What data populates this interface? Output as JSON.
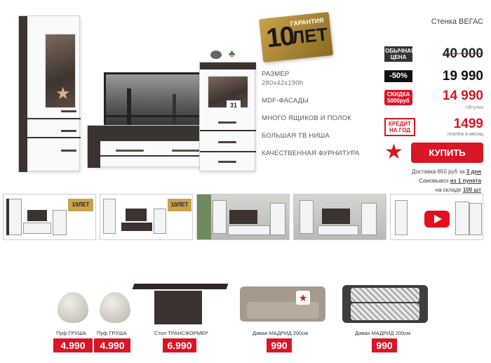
{
  "hero": {
    "guarantee": {
      "number": "10",
      "word": "ЛЕТ",
      "caption": "ГАРАНТИЯ"
    },
    "specs": [
      {
        "title": "РАЗМЕР",
        "sub": "280x42x190h"
      },
      {
        "title": "MDF-ФАСАДЫ",
        "sub": ""
      },
      {
        "title": "МНОГО ЯЩИКОВ И ПОЛОК",
        "sub": ""
      },
      {
        "title": "БОЛЬШАЯ ТВ НИША",
        "sub": ""
      },
      {
        "title": "КАЧЕСТВЕННАЯ ФУРНИТУРА",
        "sub": ""
      }
    ],
    "clock_digits": "31"
  },
  "price": {
    "product_title": "Стенка ВЕГАС",
    "old_label": "ОБЫЧНАЯ ЦЕНА",
    "old_price": "40 000",
    "discount_label": "-50%",
    "current_price": "19 990",
    "promo_label": "СКИДКА 5000руб",
    "promo_price": "14 990",
    "promo_note": "+Втулки",
    "credit_label": "КРЕДИТ НА ГОД",
    "credit_price": "1499",
    "credit_note": "платёж в месяц",
    "buy_label": "КУПИТЬ",
    "delivery_prefix": "Доставка 650 руб за",
    "delivery_days": "3 дня",
    "pickup_prefix": "Самовывоз",
    "pickup_points": "из 1 пункта",
    "stock_prefix": "на складе",
    "stock_count": "100 шт"
  },
  "thumbnails": [
    {
      "kind": "catalog-badge",
      "badge": "10ЛЕТ"
    },
    {
      "kind": "catalog-badge",
      "badge": "10ЛЕТ"
    },
    {
      "kind": "room"
    },
    {
      "kind": "room"
    },
    {
      "kind": "video",
      "icon": "play-icon"
    }
  ],
  "related": [
    {
      "name": "Пуф ГРУША",
      "price": "4.990"
    },
    {
      "name": "Пуф ГРУША",
      "price": "4.990"
    },
    {
      "name": "Стол ТРАНСФОРМЕР",
      "price": "6.990"
    },
    {
      "name": "Диван МАДРИД 200см",
      "price": "990"
    },
    {
      "name": "Диван МАДРИД 200см",
      "price": "990"
    }
  ],
  "colors": {
    "accent": "#d81626",
    "dark_wood": "#3a3330",
    "gold": "#c9a24a"
  }
}
